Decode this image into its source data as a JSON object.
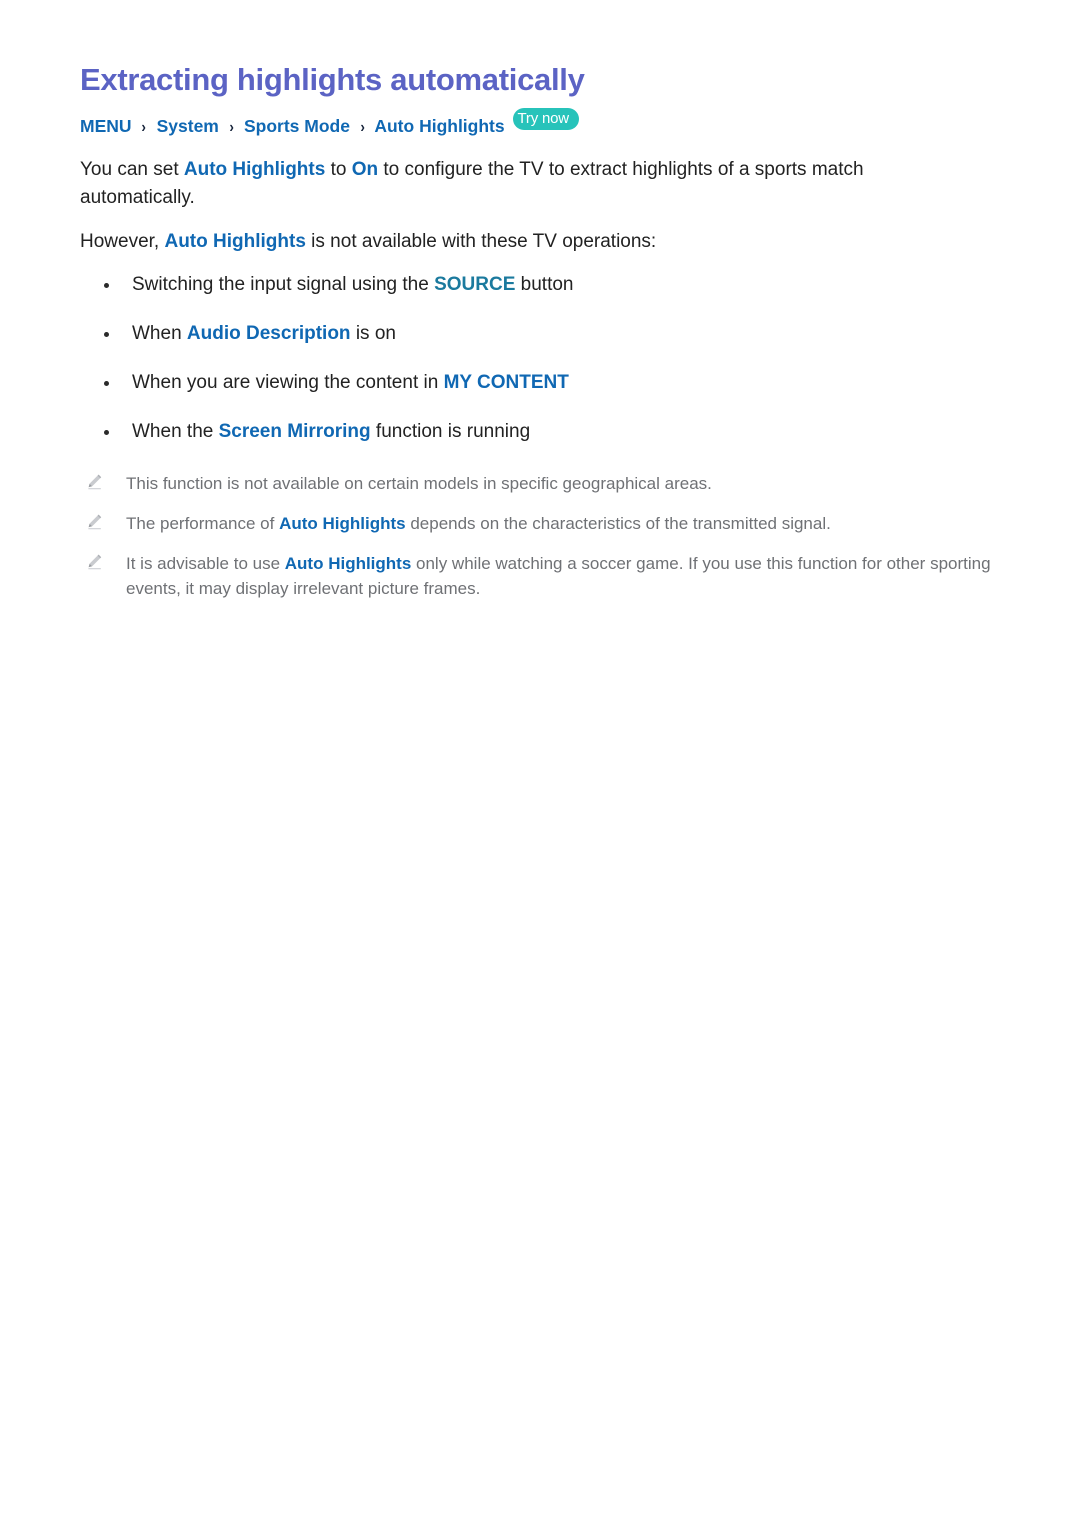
{
  "document": {
    "title": "Extracting highlights automatically",
    "breadcrumb": {
      "items": [
        "MENU",
        "System",
        "Sports Mode",
        "Auto Highlights"
      ],
      "separator": "›",
      "badge": "Try now"
    },
    "paragraphs": [
      {
        "segments": [
          {
            "text": "You can set ",
            "style": "plain"
          },
          {
            "text": "Auto Highlights",
            "style": "link"
          },
          {
            "text": " to ",
            "style": "plain"
          },
          {
            "text": "On",
            "style": "link"
          },
          {
            "text": " to configure the TV to extract highlights of a sports match automatically.",
            "style": "plain"
          }
        ]
      },
      {
        "segments": [
          {
            "text": "However, ",
            "style": "plain"
          },
          {
            "text": "Auto Highlights",
            "style": "link"
          },
          {
            "text": " is not available with these TV operations:",
            "style": "plain"
          }
        ]
      }
    ],
    "bullets": [
      {
        "segments": [
          {
            "text": "Switching the input signal using the ",
            "style": "plain"
          },
          {
            "text": "SOURCE",
            "style": "link-teal"
          },
          {
            "text": " button",
            "style": "plain"
          }
        ]
      },
      {
        "segments": [
          {
            "text": "When ",
            "style": "plain"
          },
          {
            "text": "Audio Description",
            "style": "link"
          },
          {
            "text": " is on",
            "style": "plain"
          }
        ]
      },
      {
        "segments": [
          {
            "text": "When you are viewing the content in ",
            "style": "plain"
          },
          {
            "text": "MY CONTENT",
            "style": "link-bold"
          }
        ]
      },
      {
        "segments": [
          {
            "text": "When the ",
            "style": "plain"
          },
          {
            "text": "Screen Mirroring",
            "style": "link"
          },
          {
            "text": " function is running",
            "style": "plain"
          }
        ]
      }
    ],
    "notes": [
      {
        "icon": "pencil-icon",
        "segments": [
          {
            "text": "This function is not available on certain models in specific geographical areas.",
            "style": "plain"
          }
        ]
      },
      {
        "icon": "pencil-icon",
        "segments": [
          {
            "text": "The performance of ",
            "style": "plain"
          },
          {
            "text": "Auto Highlights",
            "style": "link"
          },
          {
            "text": " depends on the characteristics of the transmitted signal.",
            "style": "plain"
          }
        ]
      },
      {
        "icon": "pencil-icon",
        "segments": [
          {
            "text": "It is advisable to use ",
            "style": "plain"
          },
          {
            "text": "Auto Highlights",
            "style": "link"
          },
          {
            "text": " only while watching a soccer game. If you use this function for other sporting events, it may display irrelevant picture frames.",
            "style": "plain"
          }
        ]
      }
    ],
    "colors": {
      "title": "#5b63c4",
      "link": "#1068b3",
      "link_teal": "#1b7a9e",
      "badge_bg": "#27c3ba",
      "badge_text": "#ffffff",
      "body_text": "#222222",
      "note_text": "#6f7175",
      "background": "#ffffff"
    }
  }
}
